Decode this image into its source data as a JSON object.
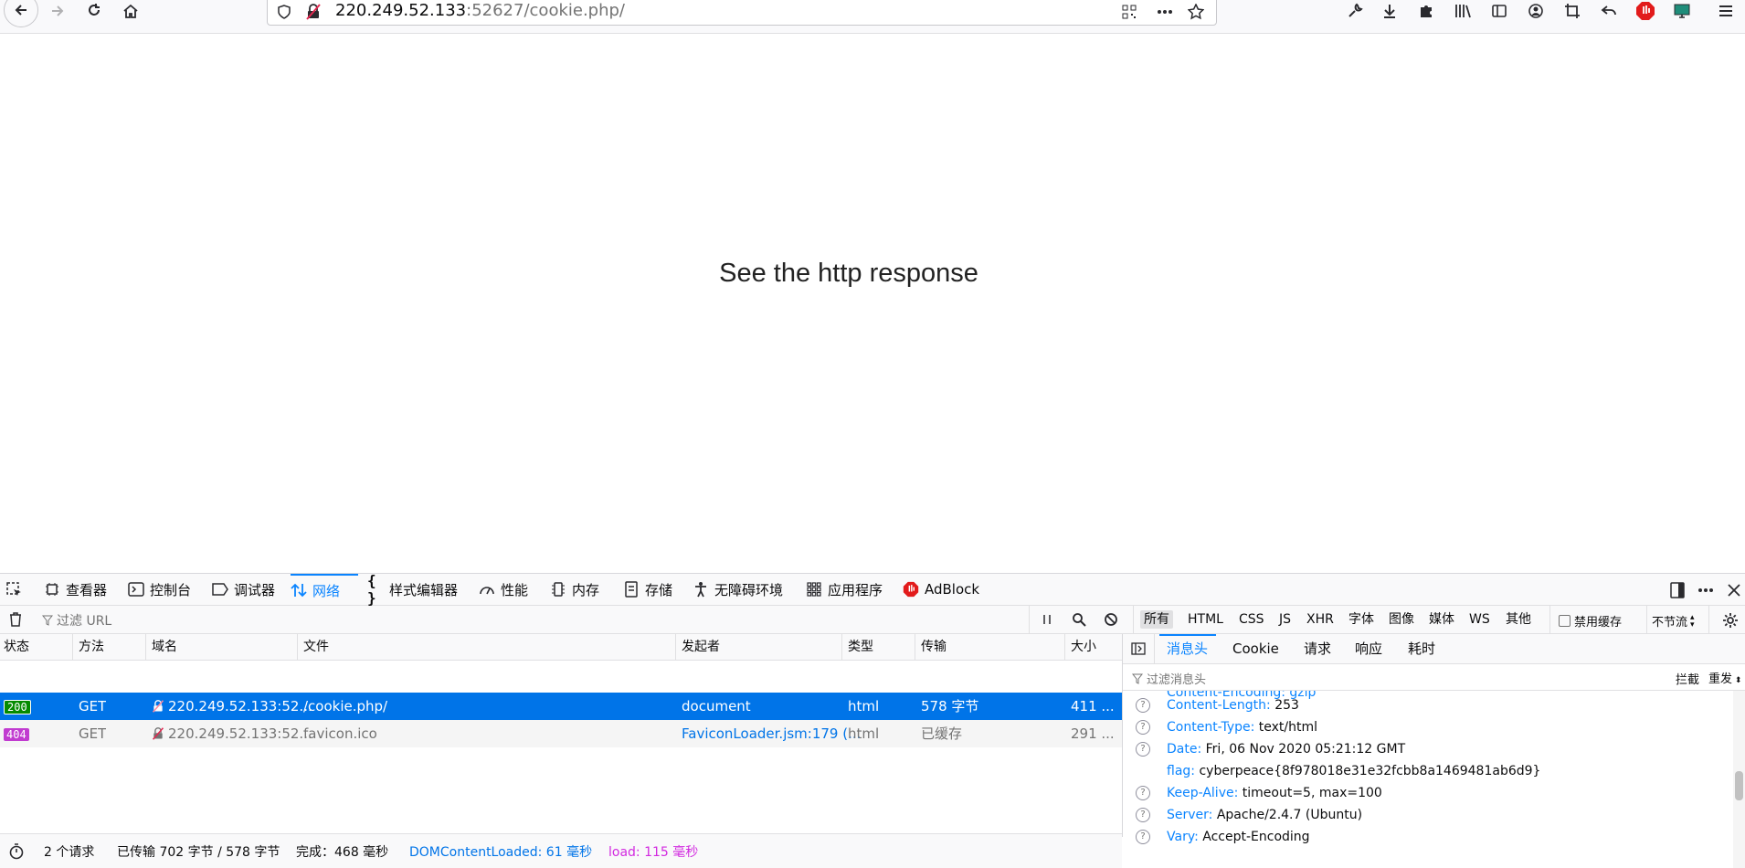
{
  "browser": {
    "url_host": "220.249.52.133",
    "url_rest": ":52627/cookie.php/"
  },
  "page": {
    "text": "See the http response"
  },
  "devtools": {
    "tabs": [
      {
        "label": "查看器"
      },
      {
        "label": "控制台"
      },
      {
        "label": "调试器"
      },
      {
        "label": "网络"
      },
      {
        "label": "样式编辑器"
      },
      {
        "label": "性能"
      },
      {
        "label": "内存"
      },
      {
        "label": "存储"
      },
      {
        "label": "无障碍环境"
      },
      {
        "label": "应用程序"
      },
      {
        "label": "AdBlock"
      }
    ],
    "active_tab": "网络",
    "filter_placeholder": "过滤 URL",
    "type_filters": [
      "所有",
      "HTML",
      "CSS",
      "JS",
      "XHR",
      "字体",
      "图像",
      "媒体",
      "WS",
      "其他"
    ],
    "disable_cache_label": "禁用缓存",
    "throttle_label": "不节流",
    "columns": [
      "状态",
      "方法",
      "域名",
      "文件",
      "发起者",
      "类型",
      "传输",
      "大小"
    ],
    "requests": [
      {
        "status": "200",
        "method": "GET",
        "domain": "220.249.52.133:52...",
        "file": "/cookie.php/",
        "initiator": "document",
        "type": "html",
        "transfer": "578 字节",
        "size": "411 ..."
      },
      {
        "status": "404",
        "method": "GET",
        "domain": "220.249.52.133:52...",
        "file": "favicon.ico",
        "initiator": "FaviconLoader.jsm:179 (...",
        "type": "html",
        "transfer": "已缓存",
        "size": "291 ..."
      }
    ],
    "footer": {
      "requests": "2 个请求",
      "transferred": "已传输 702 字节 / 578 字节",
      "finish": "完成：468 毫秒",
      "domcontentloaded": "DOMContentLoaded: 61 毫秒",
      "load": "load: 115 毫秒"
    },
    "side_tabs": [
      "消息头",
      "Cookie",
      "请求",
      "响应",
      "耗时"
    ],
    "header_filter_placeholder": "过滤消息头",
    "block_label": "拦截",
    "resend_label": "重发",
    "headers": [
      {
        "name": "Content-Length:",
        "value": "253"
      },
      {
        "name": "Content-Type:",
        "value": "text/html"
      },
      {
        "name": "Date:",
        "value": "Fri, 06 Nov 2020 05:21:12 GMT"
      },
      {
        "name": "flag:",
        "value": "cyberpeace{8f978018e31e32fcbb8a1469481ab6d9}"
      },
      {
        "name": "Keep-Alive:",
        "value": "timeout=5, max=100"
      },
      {
        "name": "Server:",
        "value": "Apache/2.4.7 (Ubuntu)"
      },
      {
        "name": "Vary:",
        "value": "Accept-Encoding"
      }
    ],
    "partial_header_top": "Content-Encoding: gzip"
  },
  "colors": {
    "accent": "#0a84ff",
    "selected_row": "#0074e8",
    "status_ok": "#058b00",
    "status_404": "#c13bd0",
    "dcl_color": "#0074e8",
    "load_color": "#d22ae0"
  }
}
